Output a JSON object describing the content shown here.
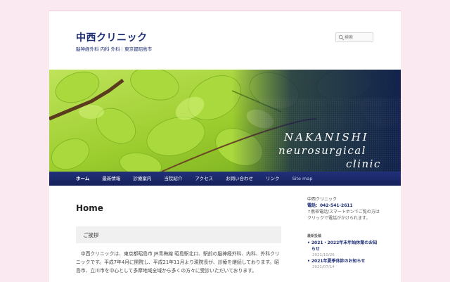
{
  "site": {
    "title": "中西クリニック",
    "description": "脳神経外科 内科 外科｜東京都昭島市"
  },
  "search": {
    "placeholder": "検索"
  },
  "banner": {
    "text_line1": "NAKANISHI",
    "text_line2": "neurosurgical",
    "text_line3": "clinic"
  },
  "nav": {
    "items": [
      {
        "label": "ホーム"
      },
      {
        "label": "最新情報"
      },
      {
        "label": "診療案内"
      },
      {
        "label": "当院紹介"
      },
      {
        "label": "アクセス"
      },
      {
        "label": "お問い合わせ"
      },
      {
        "label": "リンク"
      },
      {
        "label": "Site map"
      }
    ]
  },
  "main": {
    "page_title": "Home",
    "section_title": "ご挨拶",
    "paragraph": "中西クリニックは、東京都昭島市 JR青梅線 昭島駅北口、駅前の脳神経外科、内科、外科クリニックです。平成7年4月に開院し、平成21年11月より現院長が、診療を継続しております。昭島市、立川市を中心として多摩地域全域から多くの方々に受診いただいております。"
  },
  "sidebar": {
    "clinic_name": "中西クリニック",
    "phone": "電話：042-541-2611",
    "note": "↑携帯電話/スマートホンでご覧の方はクリックで電話がかけられます。",
    "news_heading": "最新投稿",
    "news": [
      {
        "title": "2021・2022年末年始休業のお知らせ",
        "date": "2021/10/26"
      },
      {
        "title": "2021年夏季休診のお知らせ",
        "date": "2021/07/14"
      }
    ]
  },
  "colors": {
    "brand": "#1b2c75",
    "page_bg": "#fbe9f1",
    "nav_bg": "#1a2666"
  }
}
